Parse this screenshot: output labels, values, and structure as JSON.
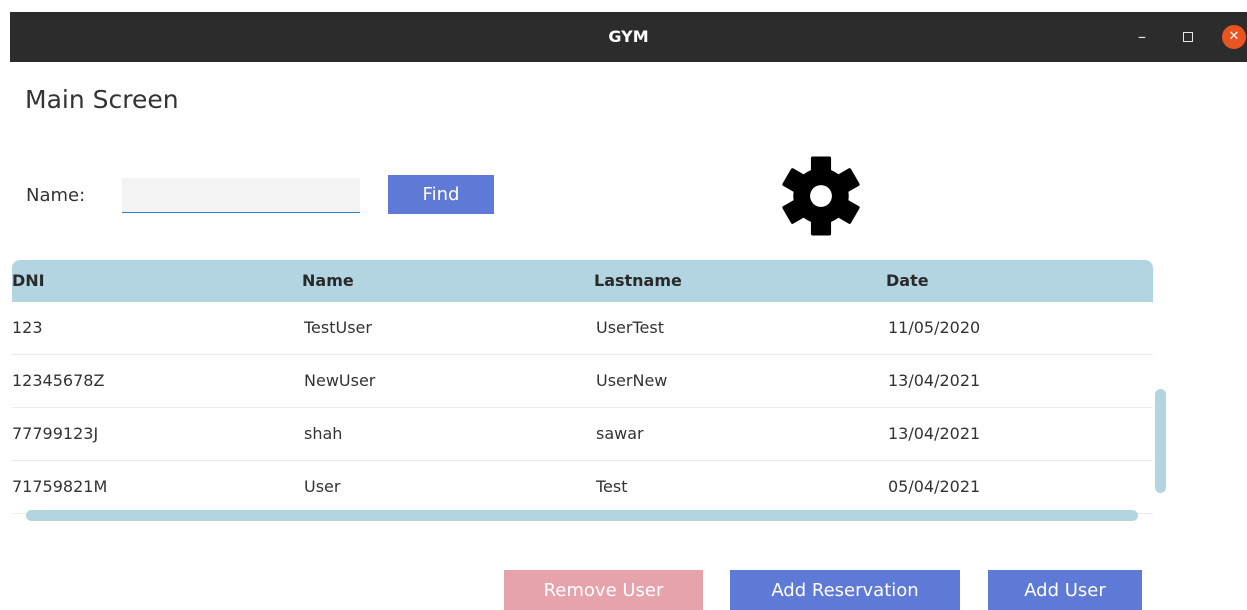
{
  "window": {
    "title": "GYM"
  },
  "page": {
    "title": "Main Screen"
  },
  "search": {
    "label": "Name:",
    "value": "",
    "find_label": "Find"
  },
  "table": {
    "columns": [
      "DNI",
      "Name",
      "Lastname",
      "Date"
    ],
    "rows": [
      [
        "123",
        "TestUser",
        "UserTest",
        "11/05/2020"
      ],
      [
        "12345678Z",
        "NewUser",
        "UserNew",
        "13/04/2021"
      ],
      [
        "77799123J",
        "shah",
        "sawar",
        "13/04/2021"
      ],
      [
        "71759821M",
        "User",
        "Test",
        "05/04/2021"
      ]
    ]
  },
  "actions": {
    "remove_label": "Remove User",
    "reservation_label": "Add Reservation",
    "add_user_label": "Add User"
  },
  "icons": {
    "settings": "gear-icon",
    "minimize": "minimize-icon",
    "maximize": "maximize-icon",
    "close": "close-icon"
  },
  "colors": {
    "titlebar": "#2c2c2c",
    "accent": "#5f79d6",
    "danger_disabled": "#e6a3ab",
    "table_header": "#b3d4e1",
    "close": "#e95420"
  }
}
